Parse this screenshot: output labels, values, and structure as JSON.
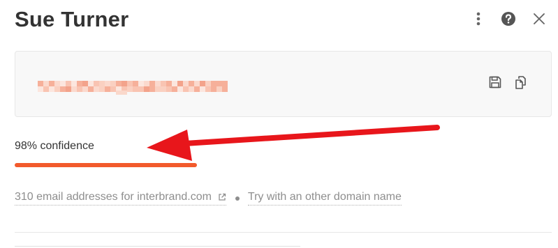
{
  "header": {
    "title": "Sue Turner",
    "actions": [
      {
        "icon": "more-vertical-icon"
      },
      {
        "icon": "help-icon"
      },
      {
        "icon": "close-icon"
      }
    ]
  },
  "email_card": {
    "email_blurred": true,
    "actions": [
      {
        "icon": "save-icon"
      },
      {
        "icon": "copy-icon"
      }
    ]
  },
  "confidence": {
    "label": "98% confidence",
    "value": 0.98,
    "color": "#f25a2c"
  },
  "annotation": {
    "arrow_color": "#e8161b"
  },
  "domain": {
    "addresses_link": "310 email addresses for interbrand.com",
    "external_icon": "external-link-icon",
    "alternate_link": "Try with an other domain name"
  },
  "colors": {
    "text": "#333333",
    "muted": "#8e8e8e",
    "card_bg": "#f8f8f8"
  }
}
